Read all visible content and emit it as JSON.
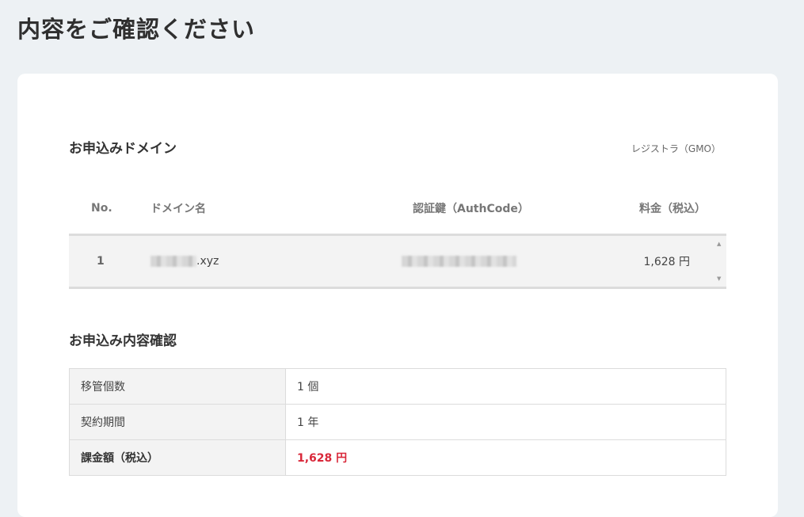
{
  "page": {
    "title": "内容をご確認ください"
  },
  "domains_section": {
    "heading": "お申込みドメイン",
    "registrar": "レジストラ（GMO）",
    "columns": {
      "no": "No.",
      "name": "ドメイン名",
      "auth": "認証鍵（AuthCode）",
      "fee": "料金（税込）"
    },
    "rows": [
      {
        "no": "1",
        "domain_suffix": ".xyz",
        "fee": "1,628 円"
      }
    ]
  },
  "confirm_section": {
    "heading": "お申込み内容確認",
    "rows": [
      {
        "label": "移管個数",
        "value": "1 個"
      },
      {
        "label": "契約期間",
        "value": "1 年"
      },
      {
        "label": "課金額（税込）",
        "value": "1,628 円"
      }
    ]
  },
  "colors": {
    "background": "#edf1f4",
    "accent_red": "#d9283a",
    "card": "#ffffff"
  }
}
